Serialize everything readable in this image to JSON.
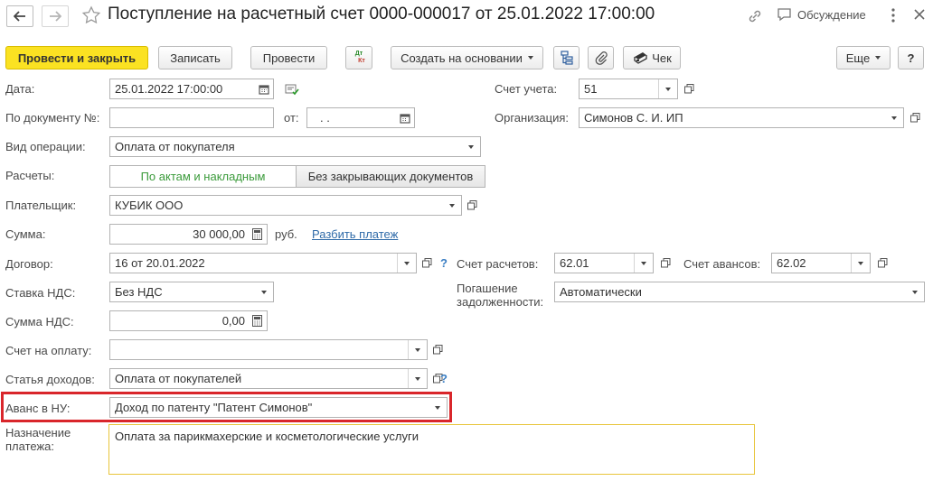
{
  "header": {
    "title": "Поступление на расчетный счет 0000-000017 от 25.01.2022 17:00:00",
    "discussion": "Обсуждение"
  },
  "toolbar": {
    "post_close": "Провести и закрыть",
    "save": "Записать",
    "post": "Провести",
    "dtkt_top": "Дт",
    "dtkt_bottom": "Кт",
    "create_based": "Создать на основании",
    "check": "Чек",
    "more": "Еще",
    "help": "?"
  },
  "form": {
    "date_label": "Дата:",
    "date_value": "25.01.2022 17:00:00",
    "doc_num_label": "По документу №:",
    "doc_num_value": "",
    "from_label": "от:",
    "from_value": ". .",
    "operation_label": "Вид операции:",
    "operation_value": "Оплата от покупателя",
    "settlements_label": "Расчеты:",
    "settlements_option1": "По актам и накладным",
    "settlements_option2": "Без закрывающих документов",
    "payer_label": "Плательщик:",
    "payer_value": "КУБИК ООО",
    "amount_label": "Сумма:",
    "amount_value": "30 000,00",
    "currency": "руб.",
    "split_link": "Разбить платеж",
    "contract_label": "Договор:",
    "contract_value": "16 от 20.01.2022",
    "vat_rate_label": "Ставка НДС:",
    "vat_rate_value": "Без НДС",
    "vat_sum_label": "Сумма НДС:",
    "vat_sum_value": "0,00",
    "invoice_label": "Счет на оплату:",
    "invoice_value": "",
    "income_label": "Статья доходов:",
    "income_value": "Оплата от покупателей",
    "advance_label": "Аванс в НУ:",
    "advance_value": "Доход по патенту \"Патент Симонов\"",
    "purpose_label_1": "Назначение",
    "purpose_label_2": "платежа:",
    "purpose_value": "Оплата за парикмахерские и косметологические услуги",
    "account_label": "Счет учета:",
    "account_value": "51",
    "org_label": "Организация:",
    "org_value": "Симонов С. И. ИП",
    "settle_acc_label": "Счет расчетов:",
    "settle_acc_value": "62.01",
    "adv_acc_label": "Счет авансов:",
    "adv_acc_value": "62.02",
    "debt_label_1": "Погашение",
    "debt_label_2": "задолженности:",
    "debt_value": "Автоматически",
    "question": "?"
  },
  "colors": {
    "primary_button": "#fbe222",
    "highlight_box": "#d9262b",
    "active_field_border": "#e8c53a",
    "selected_segment_text": "#3a9a3a",
    "link": "#2e6aa8"
  }
}
